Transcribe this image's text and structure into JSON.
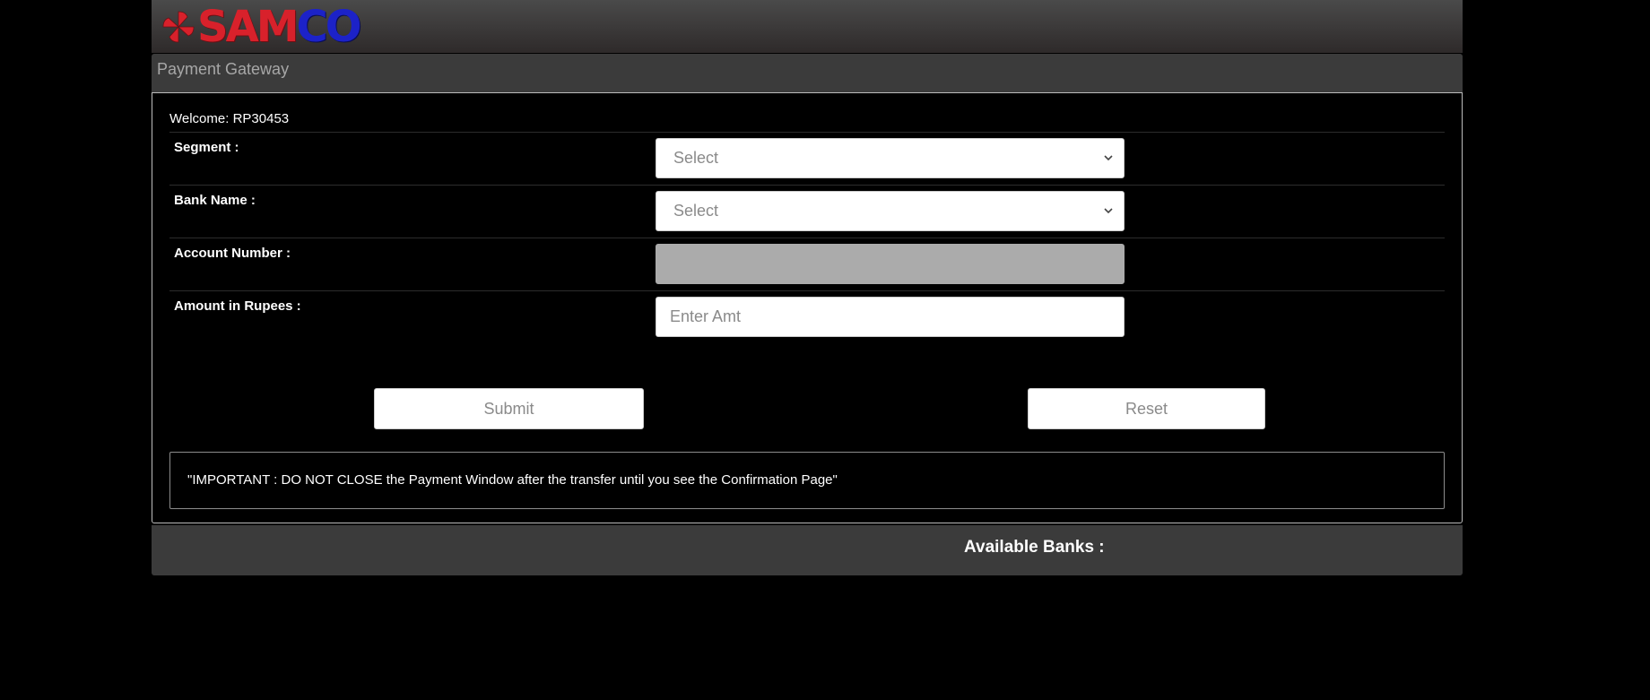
{
  "header": {
    "logo": {
      "text_part1": "SAM",
      "text_part2": "CO",
      "part1_color": "#d8212b",
      "part2_color": "#1c22c8",
      "mark_icon": "pinwheel-logo-icon"
    }
  },
  "title_bar": {
    "title": "Payment Gateway"
  },
  "form": {
    "welcome": "Welcome: RP30453",
    "segment": {
      "label": "Segment :",
      "value": "Select"
    },
    "bank_name": {
      "label": "Bank Name :",
      "value": "Select"
    },
    "account_number": {
      "label": "Account Number :",
      "value": ""
    },
    "amount": {
      "label": "Amount in Rupees :",
      "placeholder": "Enter Amt",
      "value": ""
    },
    "buttons": {
      "submit": "Submit",
      "reset": "Reset"
    },
    "notice": "\"IMPORTANT : DO NOT CLOSE the Payment Window after the transfer until you see the Confirmation Page\""
  },
  "banks": {
    "title": "Available Banks :"
  }
}
